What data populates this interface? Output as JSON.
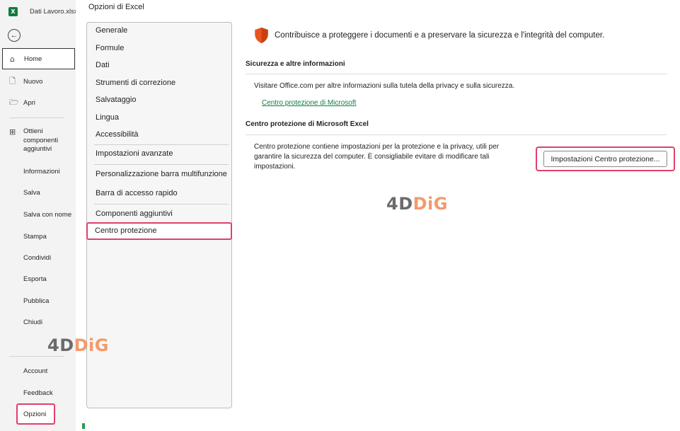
{
  "backstage": {
    "app_icon_letter": "X",
    "filename": "Dati Lavoro.xlsx  •",
    "back_icon": "←",
    "items": [
      {
        "label": "Home",
        "icon": "⌂"
      },
      {
        "label": "Nuovo",
        "icon": "🗋"
      },
      {
        "label": "Apri",
        "icon": "🗁"
      },
      {
        "label": "Ottieni componenti aggiuntivi",
        "icon": "⊞"
      },
      {
        "label": "Informazioni"
      },
      {
        "label": "Salva"
      },
      {
        "label": "Salva con nome"
      },
      {
        "label": "Stampa"
      },
      {
        "label": "Condividi"
      },
      {
        "label": "Esporta"
      },
      {
        "label": "Pubblica"
      },
      {
        "label": "Chiudi"
      },
      {
        "label": "Account"
      },
      {
        "label": "Feedback"
      },
      {
        "label": "Opzioni"
      }
    ]
  },
  "dialog": {
    "title": "Opzioni di Excel",
    "categories": [
      "Generale",
      "Formule",
      "Dati",
      "Strumenti di correzione",
      "Salvataggio",
      "Lingua",
      "Accessibilità",
      "Impostazioni avanzate",
      "Personalizzazione barra multifunzione",
      "Barra di accesso rapido",
      "Componenti aggiuntivi",
      "Centro protezione"
    ],
    "selected_category": "Centro protezione"
  },
  "content": {
    "intro": "Contribuisce a proteggere i documenti e a preservare la sicurezza e l'integrità del computer.",
    "section1": {
      "heading": "Sicurezza e altre informazioni",
      "text": "Visitare Office.com per altre informazioni sulla tutela della privacy e sulla sicurezza.",
      "link": "Centro protezione di Microsoft"
    },
    "section2": {
      "heading": "Centro protezione di Microsoft Excel",
      "text": "Centro protezione contiene impostazioni per la protezione e la privacy, utili per garantire la sicurezza del computer. È consigliabile evitare di modificare tali impostazioni.",
      "button": "Impostazioni Centro protezione..."
    }
  },
  "watermark": {
    "part1": "4D",
    "part2": "DiG"
  },
  "colors": {
    "accent": "#107c41",
    "highlight": "#e0406a",
    "shield": "#e8531f"
  }
}
